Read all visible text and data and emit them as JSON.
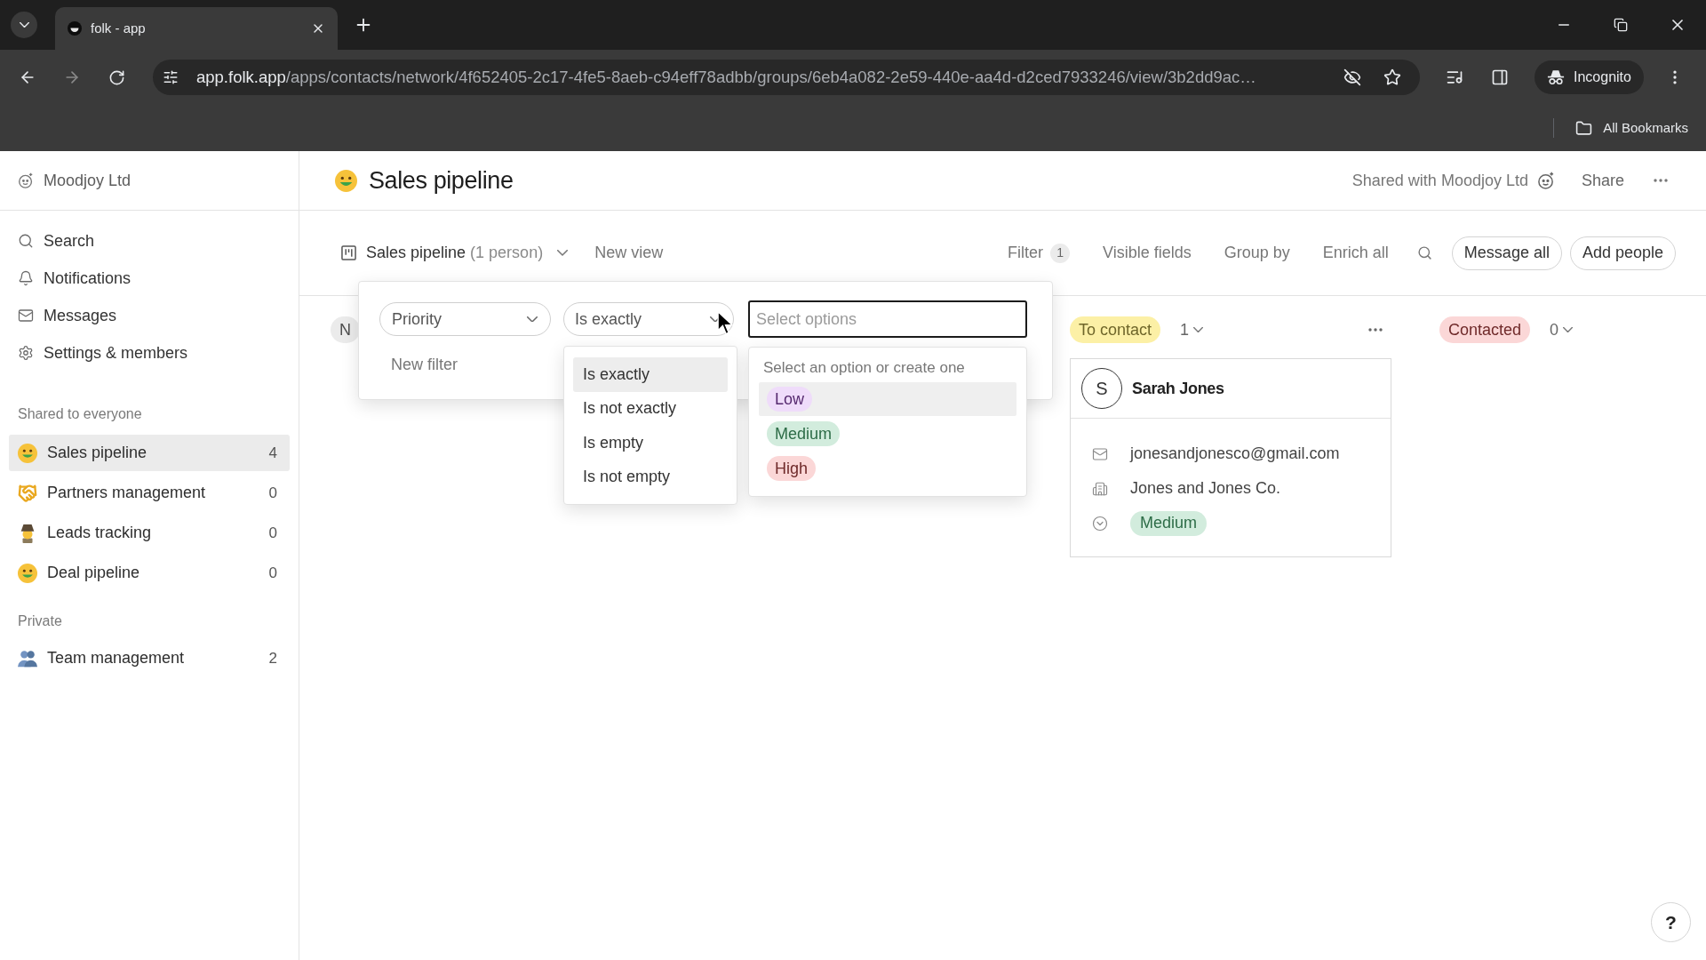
{
  "browser": {
    "tab_title": "folk - app",
    "url": {
      "domain": "app.folk.app",
      "path": "/apps/contacts/network/4f652405-2c17-4fe5-8aeb-c94eff78adbb/groups/6eb4a082-2e59-440e-aa4d-d2ced7933246/view/3b2dd9ac…"
    },
    "profile": "Incognito",
    "bookmarks": "All Bookmarks"
  },
  "sidebar": {
    "workspace": "Moodjoy Ltd",
    "nav": [
      "Search",
      "Notifications",
      "Messages",
      "Settings & members"
    ],
    "sections": [
      {
        "title": "Shared to everyone",
        "items": [
          {
            "label": "Sales pipeline",
            "count": "4",
            "selected": true
          },
          {
            "label": "Partners management",
            "count": "0",
            "selected": false
          },
          {
            "label": "Leads tracking",
            "count": "0",
            "selected": false
          },
          {
            "label": "Deal pipeline",
            "count": "0",
            "selected": false
          }
        ]
      },
      {
        "title": "Private",
        "items": [
          {
            "label": "Team management",
            "count": "2",
            "selected": false
          }
        ]
      }
    ]
  },
  "header": {
    "title": "Sales pipeline",
    "shared_label": "Shared with Moodjoy Ltd",
    "share": "Share"
  },
  "toolbar": {
    "view_name": "Sales pipeline",
    "view_count": "(1 person)",
    "new_view": "New view",
    "filter": {
      "label": "Filter",
      "count": "1"
    },
    "actions": [
      "Visible fields",
      "Group by",
      "Enrich all"
    ],
    "buttons": [
      "Message all",
      "Add people"
    ]
  },
  "board": {
    "columns": [
      {
        "label": "N",
        "color": "#ebebeb"
      },
      {
        "label": "To contact",
        "color": "#fcf0a6",
        "count": "1",
        "menu": true,
        "cards": [
          {
            "avatar": "S",
            "name": "Sarah Jones",
            "email": "jonesandjonesco@gmail.com",
            "company": "Jones and Jones Co.",
            "priority": {
              "label": "Medium",
              "color": "#d2ecdd"
            }
          }
        ]
      },
      {
        "label": "Contacted",
        "color": "#fbd7d7",
        "count": "0",
        "menu": false
      }
    ]
  },
  "filter_popover": {
    "field": "Priority",
    "operator": "Is exactly",
    "value_placeholder": "Select options",
    "new_filter": "New filter",
    "operator_menu": [
      {
        "label": "Is exactly",
        "selected": true
      },
      {
        "label": "Is not exactly",
        "selected": false
      },
      {
        "label": "Is empty",
        "selected": false
      },
      {
        "label": "Is not empty",
        "selected": false
      }
    ],
    "options_hint": "Select an option or create one",
    "options": [
      {
        "label": "Low",
        "color": "#efdcfa",
        "highlighted": true
      },
      {
        "label": "Medium",
        "color": "#d2ecdd",
        "highlighted": false
      },
      {
        "label": "High",
        "color": "#fbd7d7",
        "highlighted": false
      }
    ]
  },
  "help": "?"
}
